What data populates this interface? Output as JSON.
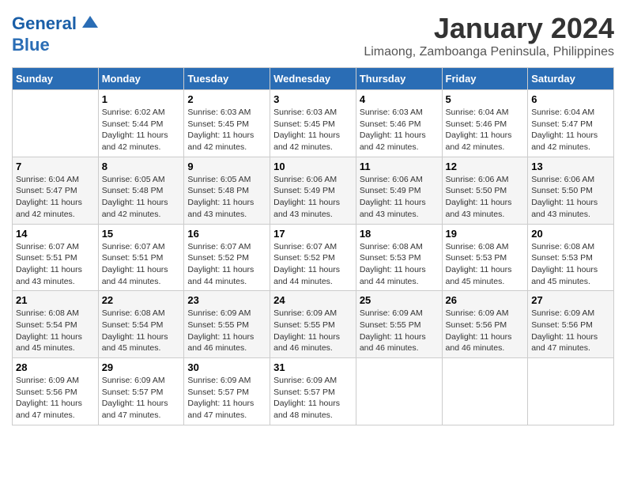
{
  "header": {
    "logo_line1": "General",
    "logo_line2": "Blue",
    "main_title": "January 2024",
    "subtitle": "Limaong, Zamboanga Peninsula, Philippines"
  },
  "days_of_week": [
    "Sunday",
    "Monday",
    "Tuesday",
    "Wednesday",
    "Thursday",
    "Friday",
    "Saturday"
  ],
  "weeks": [
    [
      {
        "day": "",
        "info": ""
      },
      {
        "day": "1",
        "info": "Sunrise: 6:02 AM\nSunset: 5:44 PM\nDaylight: 11 hours\nand 42 minutes."
      },
      {
        "day": "2",
        "info": "Sunrise: 6:03 AM\nSunset: 5:45 PM\nDaylight: 11 hours\nand 42 minutes."
      },
      {
        "day": "3",
        "info": "Sunrise: 6:03 AM\nSunset: 5:45 PM\nDaylight: 11 hours\nand 42 minutes."
      },
      {
        "day": "4",
        "info": "Sunrise: 6:03 AM\nSunset: 5:46 PM\nDaylight: 11 hours\nand 42 minutes."
      },
      {
        "day": "5",
        "info": "Sunrise: 6:04 AM\nSunset: 5:46 PM\nDaylight: 11 hours\nand 42 minutes."
      },
      {
        "day": "6",
        "info": "Sunrise: 6:04 AM\nSunset: 5:47 PM\nDaylight: 11 hours\nand 42 minutes."
      }
    ],
    [
      {
        "day": "7",
        "info": "Sunrise: 6:04 AM\nSunset: 5:47 PM\nDaylight: 11 hours\nand 42 minutes."
      },
      {
        "day": "8",
        "info": "Sunrise: 6:05 AM\nSunset: 5:48 PM\nDaylight: 11 hours\nand 42 minutes."
      },
      {
        "day": "9",
        "info": "Sunrise: 6:05 AM\nSunset: 5:48 PM\nDaylight: 11 hours\nand 43 minutes."
      },
      {
        "day": "10",
        "info": "Sunrise: 6:06 AM\nSunset: 5:49 PM\nDaylight: 11 hours\nand 43 minutes."
      },
      {
        "day": "11",
        "info": "Sunrise: 6:06 AM\nSunset: 5:49 PM\nDaylight: 11 hours\nand 43 minutes."
      },
      {
        "day": "12",
        "info": "Sunrise: 6:06 AM\nSunset: 5:50 PM\nDaylight: 11 hours\nand 43 minutes."
      },
      {
        "day": "13",
        "info": "Sunrise: 6:06 AM\nSunset: 5:50 PM\nDaylight: 11 hours\nand 43 minutes."
      }
    ],
    [
      {
        "day": "14",
        "info": "Sunrise: 6:07 AM\nSunset: 5:51 PM\nDaylight: 11 hours\nand 43 minutes."
      },
      {
        "day": "15",
        "info": "Sunrise: 6:07 AM\nSunset: 5:51 PM\nDaylight: 11 hours\nand 44 minutes."
      },
      {
        "day": "16",
        "info": "Sunrise: 6:07 AM\nSunset: 5:52 PM\nDaylight: 11 hours\nand 44 minutes."
      },
      {
        "day": "17",
        "info": "Sunrise: 6:07 AM\nSunset: 5:52 PM\nDaylight: 11 hours\nand 44 minutes."
      },
      {
        "day": "18",
        "info": "Sunrise: 6:08 AM\nSunset: 5:53 PM\nDaylight: 11 hours\nand 44 minutes."
      },
      {
        "day": "19",
        "info": "Sunrise: 6:08 AM\nSunset: 5:53 PM\nDaylight: 11 hours\nand 45 minutes."
      },
      {
        "day": "20",
        "info": "Sunrise: 6:08 AM\nSunset: 5:53 PM\nDaylight: 11 hours\nand 45 minutes."
      }
    ],
    [
      {
        "day": "21",
        "info": "Sunrise: 6:08 AM\nSunset: 5:54 PM\nDaylight: 11 hours\nand 45 minutes."
      },
      {
        "day": "22",
        "info": "Sunrise: 6:08 AM\nSunset: 5:54 PM\nDaylight: 11 hours\nand 45 minutes."
      },
      {
        "day": "23",
        "info": "Sunrise: 6:09 AM\nSunset: 5:55 PM\nDaylight: 11 hours\nand 46 minutes."
      },
      {
        "day": "24",
        "info": "Sunrise: 6:09 AM\nSunset: 5:55 PM\nDaylight: 11 hours\nand 46 minutes."
      },
      {
        "day": "25",
        "info": "Sunrise: 6:09 AM\nSunset: 5:55 PM\nDaylight: 11 hours\nand 46 minutes."
      },
      {
        "day": "26",
        "info": "Sunrise: 6:09 AM\nSunset: 5:56 PM\nDaylight: 11 hours\nand 46 minutes."
      },
      {
        "day": "27",
        "info": "Sunrise: 6:09 AM\nSunset: 5:56 PM\nDaylight: 11 hours\nand 47 minutes."
      }
    ],
    [
      {
        "day": "28",
        "info": "Sunrise: 6:09 AM\nSunset: 5:56 PM\nDaylight: 11 hours\nand 47 minutes."
      },
      {
        "day": "29",
        "info": "Sunrise: 6:09 AM\nSunset: 5:57 PM\nDaylight: 11 hours\nand 47 minutes."
      },
      {
        "day": "30",
        "info": "Sunrise: 6:09 AM\nSunset: 5:57 PM\nDaylight: 11 hours\nand 47 minutes."
      },
      {
        "day": "31",
        "info": "Sunrise: 6:09 AM\nSunset: 5:57 PM\nDaylight: 11 hours\nand 48 minutes."
      },
      {
        "day": "",
        "info": ""
      },
      {
        "day": "",
        "info": ""
      },
      {
        "day": "",
        "info": ""
      }
    ]
  ]
}
